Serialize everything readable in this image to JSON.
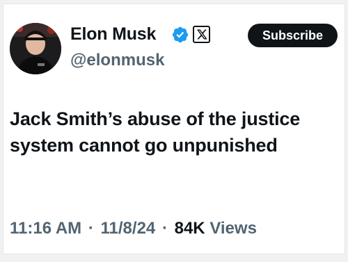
{
  "author": {
    "name": "Elon Musk",
    "handle": "@elonmusk",
    "avatar_icon": "profile-photo"
  },
  "badges": {
    "verified_icon": "verified-badge-icon",
    "verified_color": "#1d9bf0",
    "affiliation_icon": "x-logo-icon"
  },
  "actions": {
    "subscribe_label": "Subscribe"
  },
  "tweet": {
    "text": "Jack Smith’s abuse of the justice system cannot go unpunished"
  },
  "meta": {
    "time": "11:16 AM",
    "separator": "·",
    "date": "11/8/24",
    "views_count": "84K",
    "views_label": "Views"
  },
  "colors": {
    "text_primary": "#0f1419",
    "text_secondary": "#536471",
    "button_bg": "#0f1419"
  }
}
